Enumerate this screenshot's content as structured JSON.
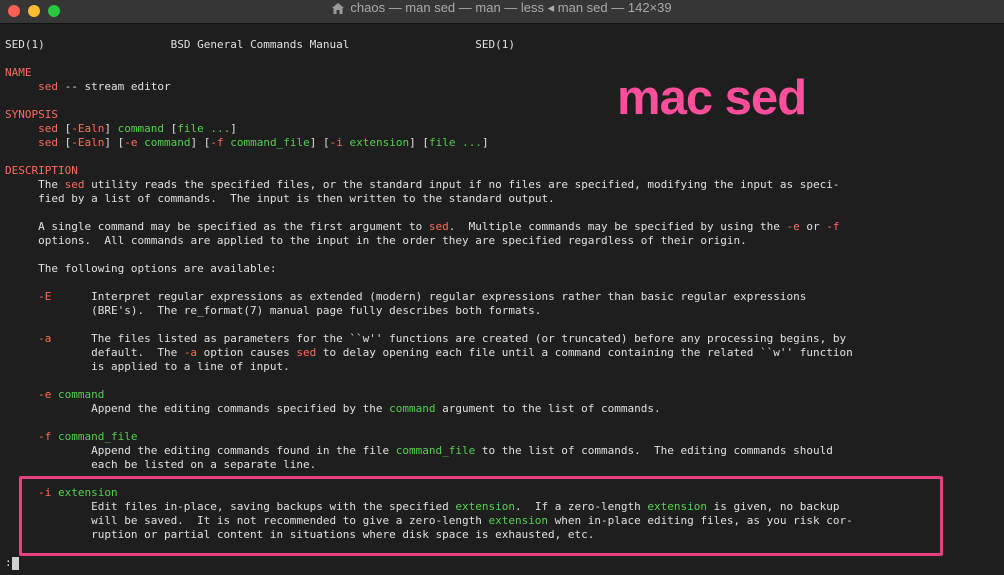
{
  "window": {
    "title": "chaos — man sed — man — less ◂ man sed — 142×39",
    "colors": {
      "keyword": "#ff6a5b",
      "argument": "#52d14f",
      "text": "#e0e0e0",
      "background": "#1e1e1e",
      "overlay": "#ff4f9a"
    }
  },
  "overlay": {
    "text": "mac sed"
  },
  "manpage": {
    "header_left": "SED(1)",
    "header_center": "BSD General Commands Manual",
    "header_right": "SED(1)",
    "section_name": "NAME",
    "name_cmd": "sed",
    "name_desc": " -- stream editor",
    "section_synopsis": "SYNOPSIS",
    "syn1": {
      "cmd": "sed",
      "p1": " [",
      "opt": "-Ealn",
      "p2": "] ",
      "arg": "command",
      "p3": " [",
      "file": "file ...",
      "p4": "]"
    },
    "syn2": {
      "cmd": "sed",
      "p1": " [",
      "opt": "-Ealn",
      "p2": "] [",
      "opt_e": "-e",
      "p3": " ",
      "arg_cmd": "command",
      "p4": "] [",
      "opt_f": "-f",
      "p5": " ",
      "arg_cf": "command_file",
      "p6": "] [",
      "opt_i": "-i",
      "p7": " ",
      "arg_ext": "extension",
      "p8": "] [",
      "file": "file ...",
      "p9": "]"
    },
    "section_description": "DESCRIPTION",
    "d1": {
      "a": "The ",
      "sed": "sed",
      "b": " utility reads the specified files, or the standard input if no files are specified, modifying the input as speci-"
    },
    "d2": "fied by a list of commands.  The input is then written to the standard output.",
    "d3": {
      "a": "A single command may be specified as the first argument to ",
      "sed": "sed",
      "b": ".  Multiple commands may be specified by using the ",
      "e": "-e",
      "c": " or ",
      "f": "-f"
    },
    "d4": "options.  All commands are applied to the input in the order they are specified regardless of their origin.",
    "d5": "The following options are available:",
    "optE": {
      "flag": "-E",
      "text1": "Interpret regular expressions as extended (modern) regular expressions rather than basic regular expressions",
      "text2": "(BRE's).  The re_format(7) manual page fully describes both formats."
    },
    "opta": {
      "flag": "-a",
      "text1": "The files listed as parameters for the ``w'' functions are created (or truncated) before any processing begins, by",
      "l2a": "default.  The ",
      "l2b": "-a",
      "l2c": " option causes ",
      "l2d": "sed",
      "l2e": " to delay opening each file until a command containing the related ``w'' function",
      "text3": "is applied to a line of input."
    },
    "opte": {
      "flag": "-e",
      "arg": "command",
      "l1a": "Append the editing commands specified by the ",
      "l1b": "command",
      "l1c": " argument to the list of commands."
    },
    "optf": {
      "flag": "-f",
      "arg": "command_file",
      "l1a": "Append the editing commands found in the file ",
      "l1b": "command_file",
      "l1c": " to the list of commands.  The editing commands should",
      "l2": "each be listed on a separate line."
    },
    "opti": {
      "flag": "-i",
      "arg": "extension",
      "l1a": "Edit files in-place, saving backups with the specified ",
      "l1b": "extension",
      "l1c": ".  If a zero-length ",
      "l1d": "extension",
      "l1e": " is given, no backup",
      "l2a": "will be saved.  It is not recommended to give a zero-length ",
      "l2b": "extension",
      "l2c": " when in-place editing files, as you risk cor-",
      "l3": "ruption or partial content in situations where disk space is exhausted, etc."
    },
    "prompt": ":"
  }
}
